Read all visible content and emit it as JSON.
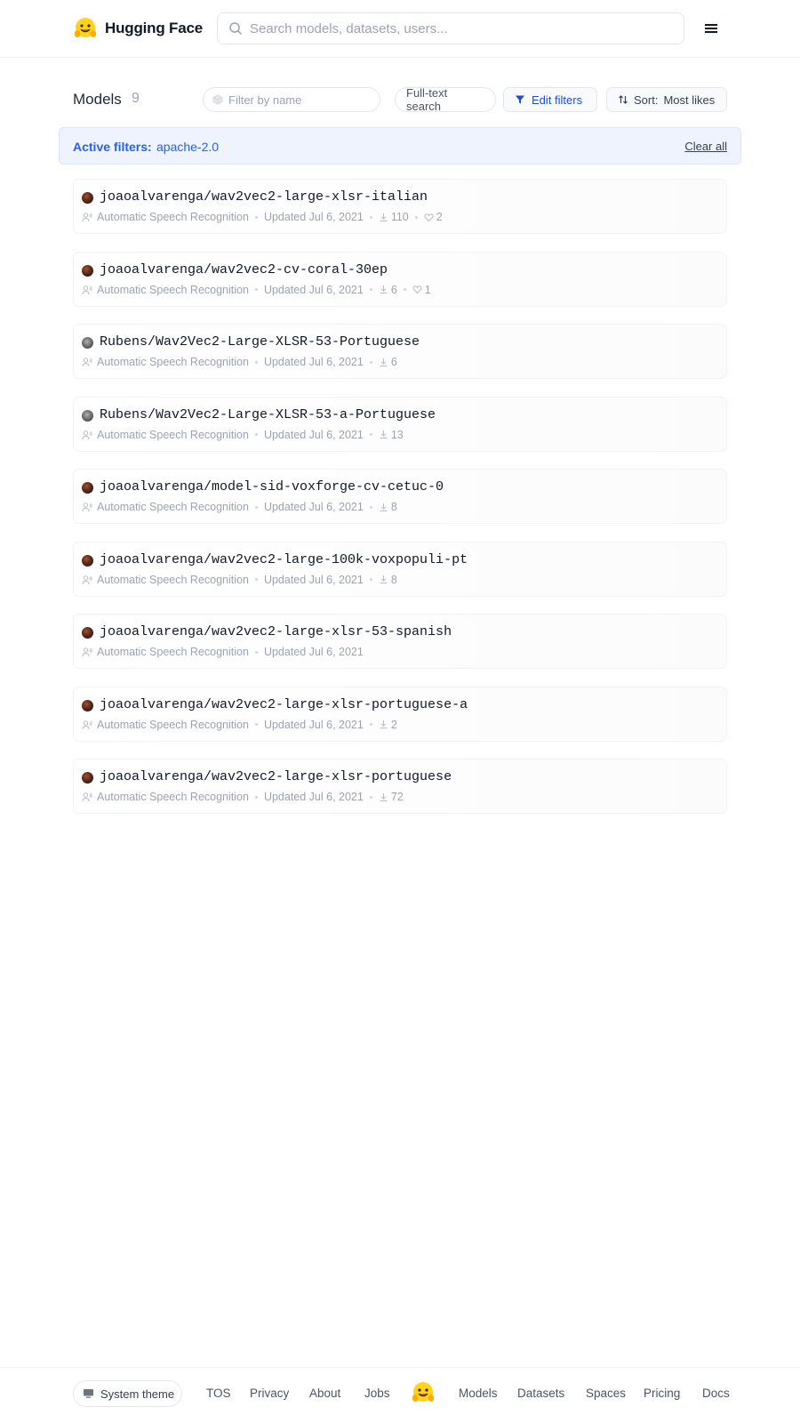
{
  "header": {
    "brand_name": "Hugging Face",
    "search_placeholder": "Search models, datasets, users..."
  },
  "toolbar": {
    "title": "Models",
    "count": "9",
    "filter_placeholder": "Filter by name",
    "fulltext_label": "Full-text search",
    "edit_filters_label": "Edit filters",
    "sort_label": "Sort:",
    "sort_value": "Most likes"
  },
  "active_filters": {
    "label": "Active filters:",
    "value": "apache-2.0",
    "clear_label": "Clear all"
  },
  "colors": {
    "accent": "#2563eb",
    "filter_bg": "#eef3fd"
  },
  "models": [
    {
      "name": "joaoalvarenga/wav2vec2-large-xlsr-italian",
      "task": "Automatic Speech Recognition",
      "updated": "Updated Jul 6, 2021",
      "downloads": "110",
      "likes": "2",
      "avatar": "dark"
    },
    {
      "name": "joaoalvarenga/wav2vec2-cv-coral-30ep",
      "task": "Automatic Speech Recognition",
      "updated": "Updated Jul 6, 2021",
      "downloads": "6",
      "likes": "1",
      "avatar": "dark"
    },
    {
      "name": "Rubens/Wav2Vec2-Large-XLSR-53-Portuguese",
      "task": "Automatic Speech Recognition",
      "updated": "Updated Jul 6, 2021",
      "downloads": "6",
      "likes": "",
      "avatar": "gray"
    },
    {
      "name": "Rubens/Wav2Vec2-Large-XLSR-53-a-Portuguese",
      "task": "Automatic Speech Recognition",
      "updated": "Updated Jul 6, 2021",
      "downloads": "13",
      "likes": "",
      "avatar": "gray"
    },
    {
      "name": "joaoalvarenga/model-sid-voxforge-cv-cetuc-0",
      "task": "Automatic Speech Recognition",
      "updated": "Updated Jul 6, 2021",
      "downloads": "8",
      "likes": "",
      "avatar": "dark"
    },
    {
      "name": "joaoalvarenga/wav2vec2-large-100k-voxpopuli-pt",
      "task": "Automatic Speech Recognition",
      "updated": "Updated Jul 6, 2021",
      "downloads": "8",
      "likes": "",
      "avatar": "dark"
    },
    {
      "name": "joaoalvarenga/wav2vec2-large-xlsr-53-spanish",
      "task": "Automatic Speech Recognition",
      "updated": "Updated Jul 6, 2021",
      "downloads": "",
      "likes": "",
      "avatar": "dark"
    },
    {
      "name": "joaoalvarenga/wav2vec2-large-xlsr-portuguese-a",
      "task": "Automatic Speech Recognition",
      "updated": "Updated Jul 6, 2021",
      "downloads": "2",
      "likes": "",
      "avatar": "dark"
    },
    {
      "name": "joaoalvarenga/wav2vec2-large-xlsr-portuguese",
      "task": "Automatic Speech Recognition",
      "updated": "Updated Jul 6, 2021",
      "downloads": "72",
      "likes": "",
      "avatar": "dark"
    }
  ],
  "footer": {
    "theme_label": "System theme",
    "links_left": [
      "TOS",
      "Privacy",
      "About",
      "Jobs"
    ],
    "links_right": [
      "Models",
      "Datasets",
      "Spaces",
      "Pricing",
      "Docs"
    ]
  }
}
